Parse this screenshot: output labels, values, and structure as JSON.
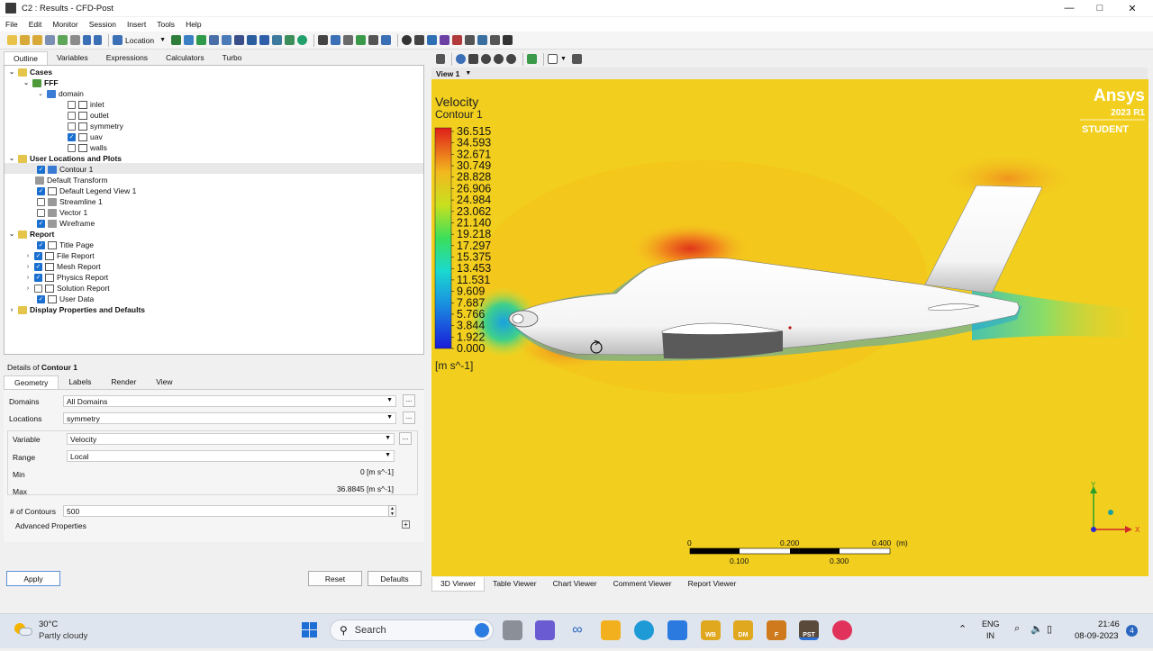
{
  "window": {
    "title": "C2 : Results - CFD-Post"
  },
  "menu": [
    "File",
    "Edit",
    "Monitor",
    "Session",
    "Insert",
    "Tools",
    "Help"
  ],
  "toolbar": {
    "location_label": "Location"
  },
  "left_tabs": [
    "Outline",
    "Variables",
    "Expressions",
    "Calculators",
    "Turbo"
  ],
  "tree": {
    "cases": "Cases",
    "case_name": "FFF",
    "domain": "domain",
    "boundaries": [
      {
        "label": "inlet",
        "checked": false
      },
      {
        "label": "outlet",
        "checked": false
      },
      {
        "label": "symmetry",
        "checked": false
      },
      {
        "label": "uav",
        "checked": true
      },
      {
        "label": "walls",
        "checked": false
      }
    ],
    "user_locations": "User Locations and Plots",
    "user_items": [
      {
        "label": "Contour 1",
        "checked": true
      },
      {
        "label": "Default Transform",
        "checked": null
      },
      {
        "label": "Default Legend View 1",
        "checked": true
      },
      {
        "label": "Streamline 1",
        "checked": false
      },
      {
        "label": "Vector 1",
        "checked": false
      },
      {
        "label": "Wireframe",
        "checked": true
      }
    ],
    "report": "Report",
    "report_items": [
      {
        "label": "Title Page",
        "checked": true,
        "expandable": false
      },
      {
        "label": "File Report",
        "checked": true,
        "expandable": true
      },
      {
        "label": "Mesh Report",
        "checked": true,
        "expandable": true
      },
      {
        "label": "Physics Report",
        "checked": true,
        "expandable": true
      },
      {
        "label": "Solution Report",
        "checked": false,
        "expandable": true
      },
      {
        "label": "User Data",
        "checked": true,
        "expandable": false
      }
    ],
    "display": "Display Properties and Defaults"
  },
  "details": {
    "title_prefix": "Details of",
    "title_object": "Contour 1",
    "tabs": [
      "Geometry",
      "Labels",
      "Render",
      "View"
    ],
    "domains_label": "Domains",
    "domains_value": "All Domains",
    "locations_label": "Locations",
    "locations_value": "symmetry",
    "variable_label": "Variable",
    "variable_value": "Velocity",
    "range_label": "Range",
    "range_value": "Local",
    "min_label": "Min",
    "min_value": "0 [m s^-1]",
    "max_label": "Max",
    "max_value": "36.8845 [m s^-1]",
    "contours_label": "# of Contours",
    "contours_value": "500",
    "advanced_label": "Advanced Properties",
    "apply": "Apply",
    "reset": "Reset",
    "defaults": "Defaults",
    "dots": "..."
  },
  "viewer": {
    "view_label": "View 1",
    "legend_title": "Velocity",
    "legend_subtitle": "Contour 1",
    "legend_values": [
      "36.515",
      "34.593",
      "32.671",
      "30.749",
      "28.828",
      "26.906",
      "24.984",
      "23.062",
      "21.140",
      "19.218",
      "17.297",
      "15.375",
      "13.453",
      "11.531",
      "9.609",
      "7.687",
      "5.766",
      "3.844",
      "1.922",
      "0.000"
    ],
    "legend_unit": "[m s^-1]",
    "brand": "Ansys",
    "version": "2023 R1",
    "edition": "STUDENT",
    "scale_top": [
      "0",
      "0.200",
      "0.400",
      "(m)"
    ],
    "scale_bottom": [
      "0.100",
      "0.300"
    ],
    "axis_y": "Y",
    "axis_x": "X",
    "colors": {
      "field_bg": "#f2cf1e",
      "hot": "#e0361a",
      "cold": "#1a3fd9"
    }
  },
  "bottom_tabs": [
    "3D Viewer",
    "Table Viewer",
    "Chart Viewer",
    "Comment Viewer",
    "Report Viewer"
  ],
  "taskbar": {
    "temp": "30°C",
    "weather": "Partly cloudy",
    "search": "Search",
    "lang1": "ENG",
    "lang2": "IN",
    "time": "21:46",
    "date": "08-09-2023",
    "badge": "4",
    "app_labels": [
      "WB",
      "DM",
      "F",
      "PST"
    ]
  }
}
